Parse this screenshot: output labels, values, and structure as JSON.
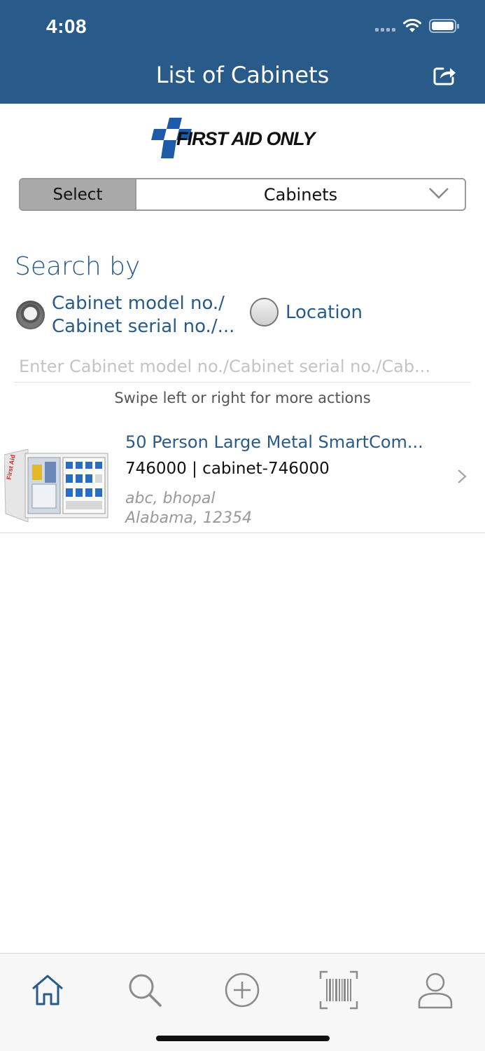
{
  "status_bar": {
    "time": "4:08"
  },
  "header": {
    "title": "List of Cabinets"
  },
  "logo": {
    "text": "FIRST AID ONLY"
  },
  "selector": {
    "label": "Select",
    "value": "Cabinets"
  },
  "search": {
    "heading": "Search by",
    "options": [
      {
        "label_line1": "Cabinet model no./",
        "label_line2": "Cabinet serial no./...",
        "selected": true
      },
      {
        "label": "Location",
        "selected": false
      }
    ],
    "placeholder": "Enter Cabinet model no./Cabinet serial no./Cab..."
  },
  "hint": "Swipe left or right for more actions",
  "items": [
    {
      "title": "50 Person Large Metal SmartCom...",
      "subtitle": "746000 | cabinet-746000",
      "location_line1": "abc, bhopal",
      "location_line2": "Alabama, 12354"
    }
  ],
  "colors": {
    "brand": "#285a8a",
    "logo_blue": "#1d5aa8"
  },
  "tabbar": {
    "tabs": [
      {
        "icon": "home-icon",
        "active": true
      },
      {
        "icon": "search-icon",
        "active": false
      },
      {
        "icon": "add-circle-icon",
        "active": false
      },
      {
        "icon": "barcode-scan-icon",
        "active": false
      },
      {
        "icon": "profile-icon",
        "active": false
      }
    ]
  }
}
